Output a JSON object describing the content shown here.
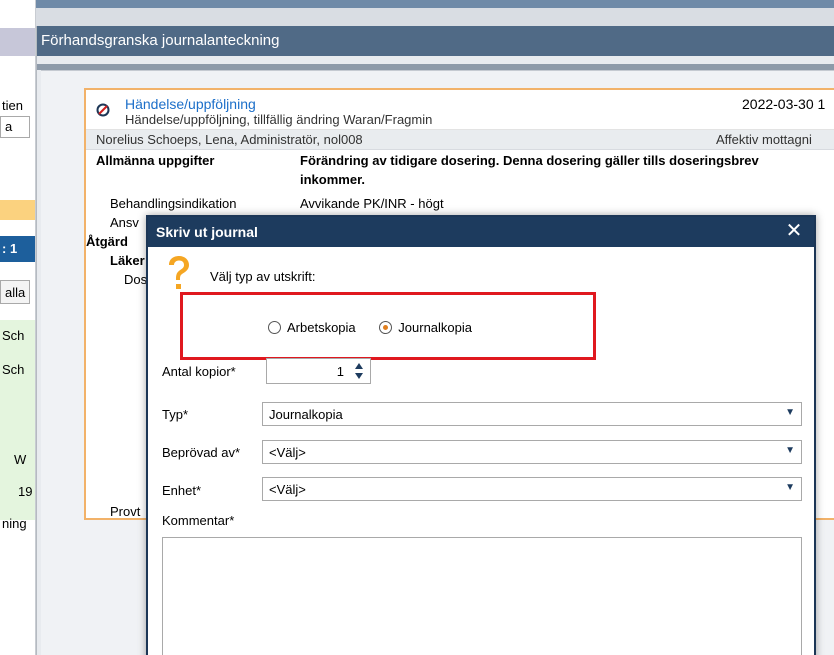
{
  "background_left": {
    "text_1": "tien",
    "text_2": "a",
    "text_3": ": 1",
    "text_4": "alla",
    "text_5": "Sch",
    "text_6": "Sch",
    "text_7": "W",
    "text_8": "19",
    "text_9": "ning"
  },
  "window": {
    "title": "Förhandsgranska journalanteckning"
  },
  "card": {
    "title": "Händelse/uppföljning",
    "subtitle": "Händelse/uppföljning, tillfällig ändring Waran/Fragmin",
    "date": "2022-03-30 1",
    "author": "Norelius Schoeps, Lena, Administratör, nol008",
    "unit": "Affektiv mottagni",
    "rows": [
      {
        "label": "Allmänna uppgifter",
        "value": "Förändring av tidigare dosering. Denna dosering gäller tills doseringsbrev"
      },
      {
        "value_cont": "inkommer."
      },
      {
        "label": "Behandlingsindikation",
        "value": "Avvikande PK/INR - högt"
      },
      {
        "label": "Ansv"
      },
      {
        "label": "Åtgärd"
      },
      {
        "label": "Läker"
      },
      {
        "label": "Dos"
      },
      {
        "label": "Provt"
      }
    ]
  },
  "dialog": {
    "title": "Skriv ut journal",
    "close_icon": "close-icon",
    "question": "Välj typ av utskrift:",
    "radio_options": [
      {
        "label": "Arbetskopia",
        "selected": false
      },
      {
        "label": "Journalkopia",
        "selected": true
      }
    ],
    "fields": {
      "copies_label": "Antal kopior*",
      "copies_value": "1",
      "type_label": "Typ*",
      "type_value": "Journalkopia",
      "approved_label": "Beprövad av*",
      "approved_value": "<Välj>",
      "unit_label": "Enhet*",
      "unit_value": "<Välj>",
      "comment_label": "Kommentar*"
    }
  },
  "colors": {
    "dialog_title_bg": "#1d3b5e",
    "window_title_bg": "#506a86",
    "card_border": "#f2b269",
    "highlight_box": "#e0181f",
    "radio_selected": "#e07f1e",
    "card_title": "#1c6fc9"
  }
}
